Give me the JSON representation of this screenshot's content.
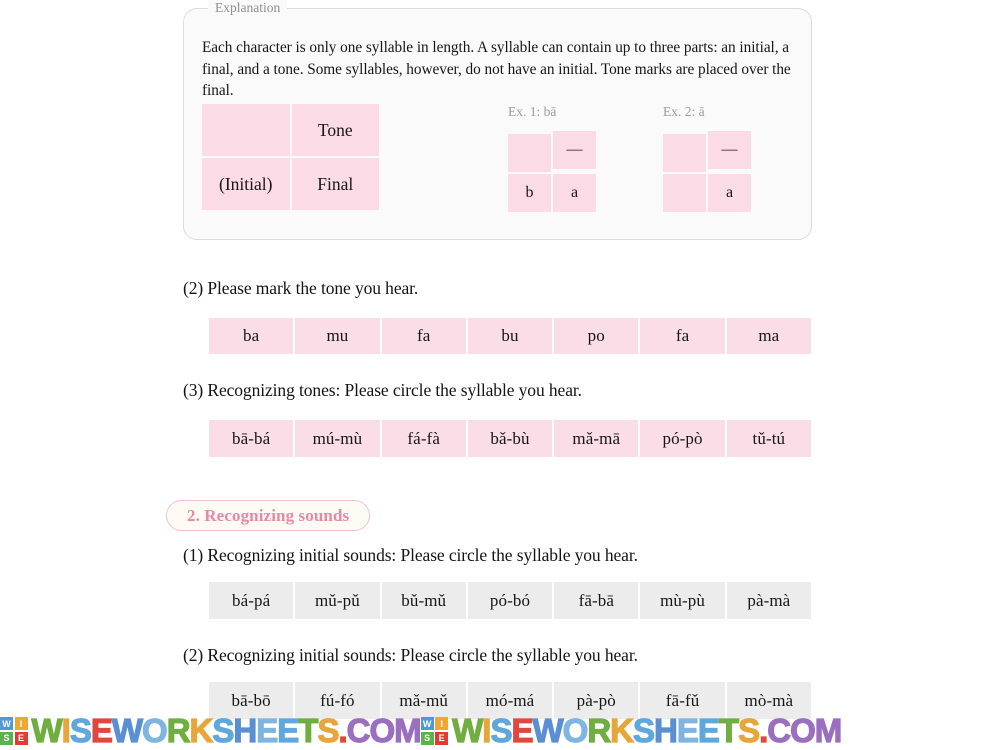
{
  "explanation": {
    "legend": "Explanation",
    "body": "Each character is only one syllable in length. A syllable can contain up to three parts: an initial, a final, and a tone. Some syllables, however, do not have an initial. Tone marks are placed over the final.",
    "structure_table": {
      "cells": [
        "",
        "Tone",
        "(Initial)",
        "Final"
      ]
    },
    "examples": [
      {
        "label": "Ex. 1: bā",
        "cells": [
          "",
          "—",
          "b",
          "a"
        ]
      },
      {
        "label": "Ex. 2: ā",
        "cells": [
          "",
          "—",
          "",
          "a"
        ]
      }
    ]
  },
  "questions": [
    {
      "text": "(2) Please mark the tone you hear.",
      "style": "pink",
      "items": [
        "ba",
        "mu",
        "fa",
        "bu",
        "po",
        "fa",
        "ma"
      ]
    },
    {
      "text": "(3) Recognizing tones: Please circle the syllable you hear.",
      "style": "pink",
      "items": [
        "bā-bá",
        "mú-mù",
        "fá-fà",
        "bǎ-bù",
        "mǎ-mā",
        "pó-pò",
        "tǔ-tú"
      ]
    },
    {
      "text": "(1) Recognizing initial sounds: Please circle the syllable you hear.",
      "style": "gray",
      "items": [
        "bá-pá",
        "mǔ-pǔ",
        "bǔ-mǔ",
        "pó-bó",
        "fā-bā",
        "mù-pù",
        "pà-mà"
      ]
    },
    {
      "text": "(2) Recognizing initial sounds: Please circle the syllable you hear.",
      "style": "gray",
      "items": [
        "bā-bō",
        "fú-fó",
        "mǎ-mǔ",
        "mó-má",
        "pà-pò",
        "fā-fǔ",
        "mò-mà"
      ]
    }
  ],
  "section_badge": {
    "label": "2. Recognizing sounds"
  },
  "watermark": {
    "logo_letters": [
      "W",
      "I",
      "S",
      "E"
    ],
    "text": "WISEWORKSHEETS.COM",
    "repeat": 2
  },
  "colors": {
    "pink_cell": "#fbdde7",
    "gray_cell": "#ececec",
    "badge_text": "#e48aa8",
    "badge_border": "#f0c3d2",
    "panel_bg": "#fafafa",
    "panel_border": "#dcdcdc"
  }
}
